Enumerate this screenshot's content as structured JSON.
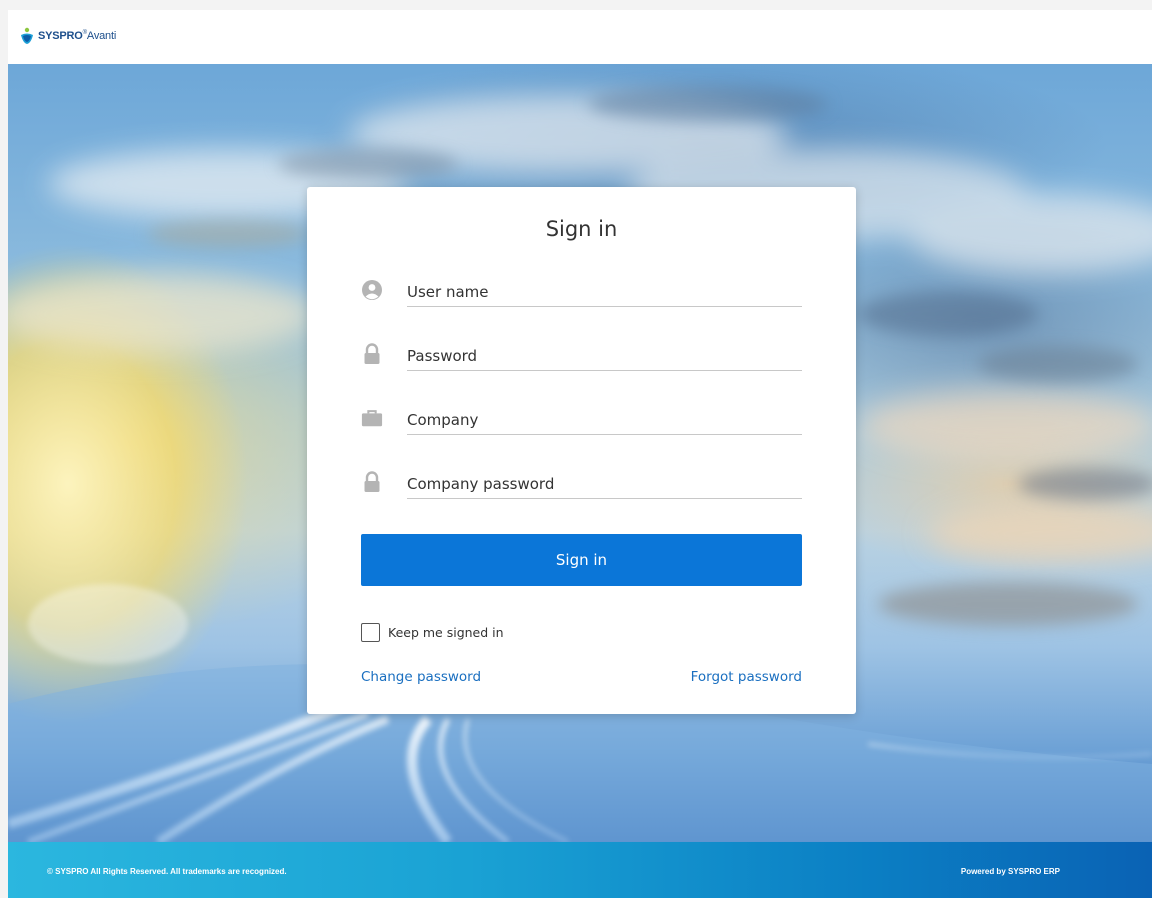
{
  "header": {
    "brand": "SYSPRO",
    "product": "Avanti"
  },
  "signin": {
    "title": "Sign in",
    "fields": [
      {
        "icon": "user-circle-icon",
        "placeholder": "User name",
        "value": ""
      },
      {
        "icon": "lock-icon",
        "placeholder": "Password",
        "value": ""
      },
      {
        "icon": "briefcase-icon",
        "placeholder": "Company",
        "value": ""
      },
      {
        "icon": "lock-icon",
        "placeholder": "Company password",
        "value": ""
      }
    ],
    "button_label": "Sign in",
    "keep_signed_in_label": "Keep me signed in",
    "keep_signed_in_checked": false,
    "change_password_label": "Change password",
    "forgot_password_label": "Forgot password"
  },
  "colors": {
    "primary": "#0b76d8",
    "link": "#1a6fc0",
    "footer_start": "#2bb7df",
    "footer_end": "#0a62b4"
  },
  "footer": {
    "copyright": "© SYSPRO All Rights Reserved. All trademarks are recognized.",
    "powered_by": "Powered by SYSPRO ERP"
  }
}
